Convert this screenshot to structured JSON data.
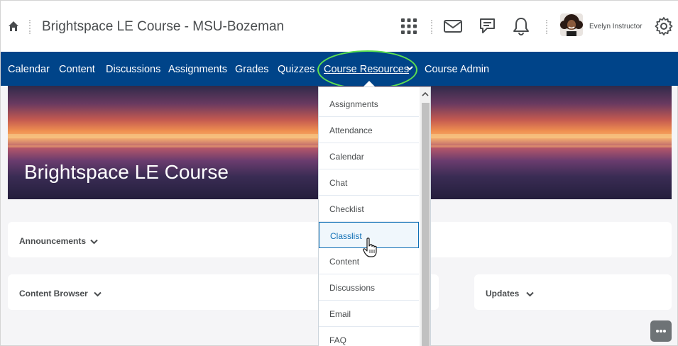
{
  "header": {
    "course_title": "Brightspace LE Course - MSU-Bozeman",
    "user_name": "Evelyn Instructor",
    "icons": [
      "home-icon",
      "apps-grid-icon",
      "mail-icon",
      "chat-icon",
      "bell-icon",
      "gear-icon"
    ]
  },
  "nav": {
    "items": [
      "Calendar",
      "Content",
      "Discussions",
      "Assignments",
      "Grades",
      "Quizzes",
      "Course Resources",
      "Course Admin"
    ],
    "active": "Course Resources",
    "highlight_color": "#5ee04f"
  },
  "banner": {
    "title": "Brightspace LE Course"
  },
  "widgets": {
    "announcements": "Announcements",
    "content_browser": "Content Browser",
    "updates": "Updates"
  },
  "dropdown": {
    "items": [
      "Assignments",
      "Attendance",
      "Calendar",
      "Chat",
      "Checklist",
      "Classlist",
      "Content",
      "Discussions",
      "Email",
      "FAQ"
    ],
    "hovered": "Classlist"
  },
  "colors": {
    "nav_bg": "#004489",
    "link_blue": "#0f6fb5"
  }
}
